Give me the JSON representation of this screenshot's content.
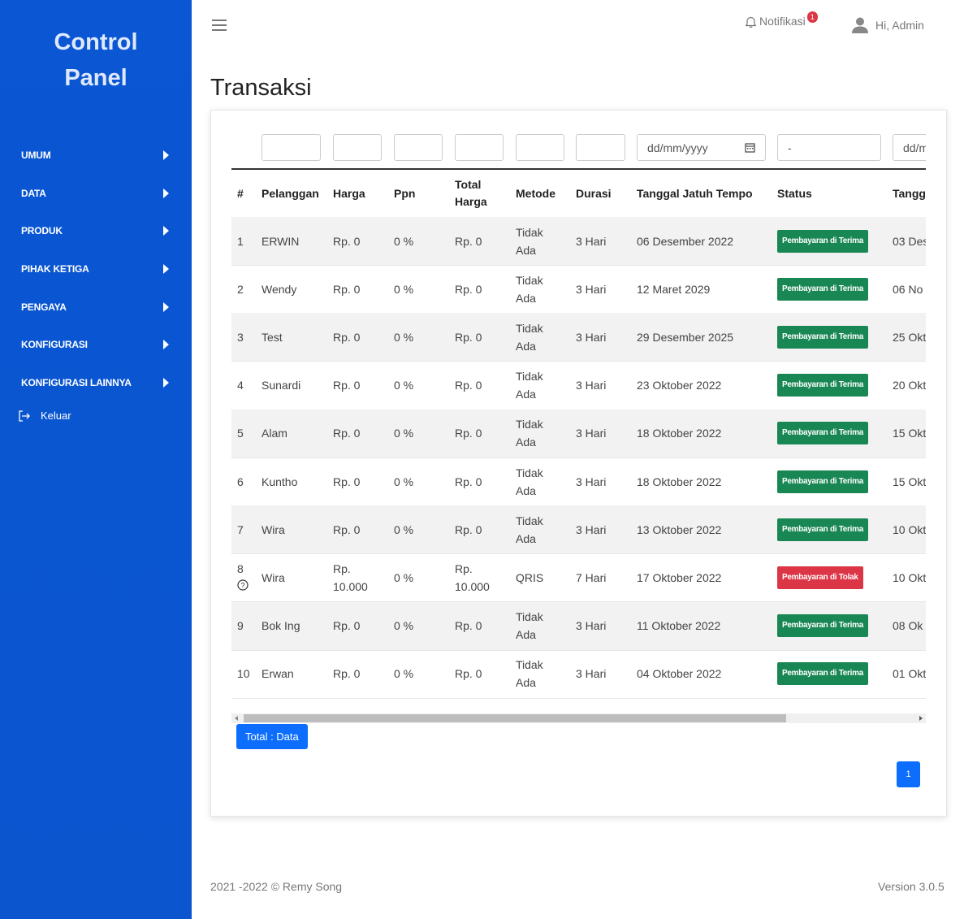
{
  "sidebar": {
    "brand_line1": "Control",
    "brand_line2": "Panel",
    "items": [
      {
        "label": "UMUM"
      },
      {
        "label": "DATA"
      },
      {
        "label": "PRODUK"
      },
      {
        "label": "PIHAK KETIGA"
      },
      {
        "label": "PENGAYA"
      },
      {
        "label": "KONFIGURASI"
      },
      {
        "label": "KONFIGURASI LAINNYA"
      }
    ],
    "logout_label": "Keluar"
  },
  "topbar": {
    "notif_label": "Notifikasi",
    "notif_count": "1",
    "user_label": "Hi, Admin"
  },
  "page": {
    "title": "Transaksi"
  },
  "filters": {
    "date_placeholder": "dd/mm/yyyy",
    "status_value": "-",
    "date2_placeholder": "dd/mm/yyyy"
  },
  "table": {
    "headers": {
      "no": "#",
      "pelanggan": "Pelanggan",
      "harga": "Harga",
      "ppn": "Ppn",
      "total_1": "Total",
      "total_2": "Harga",
      "metode": "Metode",
      "durasi": "Durasi",
      "jatuh_tempo": "Tanggal Jatuh Tempo",
      "status": "Status",
      "tanggal": "Tangg"
    },
    "rows": [
      {
        "no": "1",
        "pelanggan": "ERWIN",
        "harga": "Rp. 0",
        "ppn": "0 %",
        "total": "Rp. 0",
        "metode": "Tidak Ada",
        "durasi": "3 Hari",
        "jatuh_tempo": "06 Desember 2022",
        "status": "Pembayaran di Terima",
        "tanggal": "03 Des"
      },
      {
        "no": "2",
        "pelanggan": "Wendy",
        "harga": "Rp. 0",
        "ppn": "0 %",
        "total": "Rp. 0",
        "metode": "Tidak Ada",
        "durasi": "3 Hari",
        "jatuh_tempo": "12 Maret 2029",
        "status": "Pembayaran di Terima",
        "tanggal": "06 No"
      },
      {
        "no": "3",
        "pelanggan": "Test",
        "harga": "Rp. 0",
        "ppn": "0 %",
        "total": "Rp. 0",
        "metode": "Tidak Ada",
        "durasi": "3 Hari",
        "jatuh_tempo": "29 Desember 2025",
        "status": "Pembayaran di Terima",
        "tanggal": "25 Okt"
      },
      {
        "no": "4",
        "pelanggan": "Sunardi",
        "harga": "Rp. 0",
        "ppn": "0 %",
        "total": "Rp. 0",
        "metode": "Tidak Ada",
        "durasi": "3 Hari",
        "jatuh_tempo": "23 Oktober 2022",
        "status": "Pembayaran di Terima",
        "tanggal": "20 Okt"
      },
      {
        "no": "5",
        "pelanggan": "Alam",
        "harga": "Rp. 0",
        "ppn": "0 %",
        "total": "Rp. 0",
        "metode": "Tidak Ada",
        "durasi": "3 Hari",
        "jatuh_tempo": "18 Oktober 2022",
        "status": "Pembayaran di Terima",
        "tanggal": "15 Okt"
      },
      {
        "no": "6",
        "pelanggan": "Kuntho",
        "harga": "Rp. 0",
        "ppn": "0 %",
        "total": "Rp. 0",
        "metode": "Tidak Ada",
        "durasi": "3 Hari",
        "jatuh_tempo": "18 Oktober 2022",
        "status": "Pembayaran di Terima",
        "tanggal": "15 Okt"
      },
      {
        "no": "7",
        "pelanggan": "Wira",
        "harga": "Rp. 0",
        "ppn": "0 %",
        "total": "Rp. 0",
        "metode": "Tidak Ada",
        "durasi": "3 Hari",
        "jatuh_tempo": "13 Oktober 2022",
        "status": "Pembayaran di Terima",
        "tanggal": "10 Okt"
      },
      {
        "no": "8",
        "pelanggan": "Wira",
        "harga": "Rp. 10.000",
        "ppn": "0 %",
        "total": "Rp. 10.000",
        "metode": "QRIS",
        "durasi": "7 Hari",
        "jatuh_tempo": "17 Oktober 2022",
        "status": "Pembayaran di Tolak",
        "tanggal": "10 Okt",
        "has_help": true
      },
      {
        "no": "9",
        "pelanggan": "Bok Ing",
        "harga": "Rp. 0",
        "ppn": "0 %",
        "total": "Rp. 0",
        "metode": "Tidak Ada",
        "durasi": "3 Hari",
        "jatuh_tempo": "11 Oktober 2022",
        "status": "Pembayaran di Terima",
        "tanggal": "08 Ok"
      },
      {
        "no": "10",
        "pelanggan": "Erwan",
        "harga": "Rp. 0",
        "ppn": "0 %",
        "total": "Rp. 0",
        "metode": "Tidak Ada",
        "durasi": "3 Hari",
        "jatuh_tempo": "04 Oktober 2022",
        "status": "Pembayaran di Terima",
        "tanggal": "01 Okt"
      }
    ]
  },
  "status_colors": {
    "Pembayaran di Terima": "#198754",
    "Pembayaran di Tolak": "#dc3545"
  },
  "total_button_label": "Total : Data",
  "pagination": {
    "current": "1"
  },
  "footer": {
    "copyright": "2021 -2022 © Remy Song",
    "version": "Version 3.0.5"
  }
}
